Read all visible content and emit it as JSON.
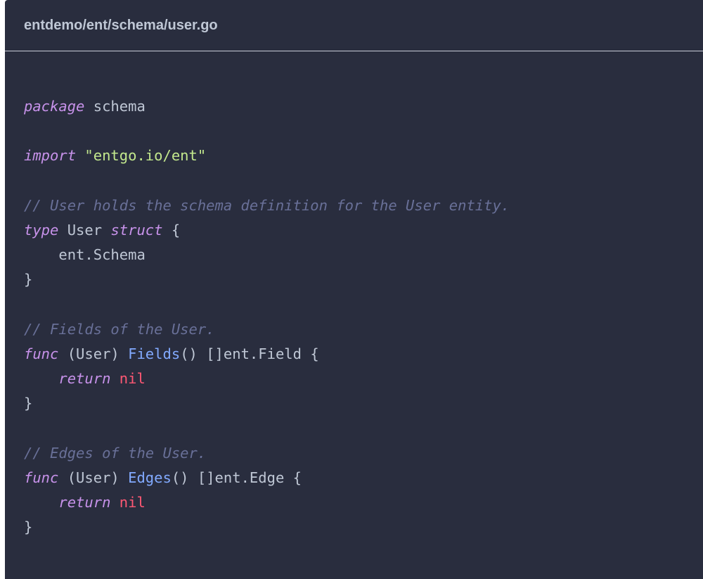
{
  "code_block": {
    "title": "entdemo/ent/schema/user.go",
    "language": "go",
    "colors": {
      "background": "#292d3e",
      "keyword": "#c792ea",
      "string": "#c3e88d",
      "comment": "#697098",
      "function": "#82aaff",
      "nil": "#ff5874",
      "text": "#bfc7d5"
    },
    "lines": [
      [
        {
          "t": "kw",
          "v": "package"
        },
        {
          "t": "plain",
          "v": " schema"
        }
      ],
      [],
      [
        {
          "t": "kw",
          "v": "import"
        },
        {
          "t": "plain",
          "v": " "
        },
        {
          "t": "str",
          "v": "\"entgo.io/ent\""
        }
      ],
      [],
      [
        {
          "t": "comment",
          "v": "// User holds the schema definition for the User entity."
        }
      ],
      [
        {
          "t": "kw",
          "v": "type"
        },
        {
          "t": "plain",
          "v": " User "
        },
        {
          "t": "kw",
          "v": "struct"
        },
        {
          "t": "plain",
          "v": " {"
        }
      ],
      [
        {
          "t": "plain",
          "v": "    ent.Schema"
        }
      ],
      [
        {
          "t": "plain",
          "v": "}"
        }
      ],
      [],
      [
        {
          "t": "comment",
          "v": "// Fields of the User."
        }
      ],
      [
        {
          "t": "kw",
          "v": "func"
        },
        {
          "t": "plain",
          "v": " (User) "
        },
        {
          "t": "fn",
          "v": "Fields"
        },
        {
          "t": "plain",
          "v": "() []ent.Field {"
        }
      ],
      [
        {
          "t": "plain",
          "v": "    "
        },
        {
          "t": "kw",
          "v": "return"
        },
        {
          "t": "plain",
          "v": " "
        },
        {
          "t": "nil",
          "v": "nil"
        }
      ],
      [
        {
          "t": "plain",
          "v": "}"
        }
      ],
      [],
      [
        {
          "t": "comment",
          "v": "// Edges of the User."
        }
      ],
      [
        {
          "t": "kw",
          "v": "func"
        },
        {
          "t": "plain",
          "v": " (User) "
        },
        {
          "t": "fn",
          "v": "Edges"
        },
        {
          "t": "plain",
          "v": "() []ent.Edge {"
        }
      ],
      [
        {
          "t": "plain",
          "v": "    "
        },
        {
          "t": "kw",
          "v": "return"
        },
        {
          "t": "plain",
          "v": " "
        },
        {
          "t": "nil",
          "v": "nil"
        }
      ],
      [
        {
          "t": "plain",
          "v": "}"
        }
      ]
    ]
  }
}
